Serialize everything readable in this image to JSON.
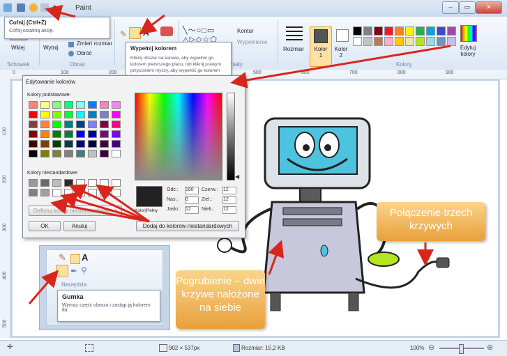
{
  "window": {
    "title": "Paint",
    "min": "‒",
    "max": "▭",
    "close": "✕"
  },
  "undo_tip": {
    "title": "Cofnij (Ctrl+Z)",
    "desc": "Cofnij ostatnią akcję."
  },
  "ribbon": {
    "clipboard": {
      "paste": "Wklej",
      "group": "Schowek"
    },
    "image": {
      "select": "Wytnij",
      "resize": "Zmień rozmiar",
      "rotate": "Obróć",
      "group": "Obraz"
    },
    "shapes": {
      "outline": "Kontur",
      "fill": "Wypełnienie",
      "group": "Kształty"
    },
    "size": "Rozmiar",
    "color1": "Kolor 1",
    "color2": "Kolor 2",
    "edit_colors": "Edytuj kolory",
    "colors_group": "Kolory"
  },
  "fill_tip": {
    "title": "Wypełnij kolorem",
    "desc": "Kliknij obszar na kanwie, aby wypełnić go kolorem pierwszego planu, lub kliknij prawym przyciskiem myszy, aby wypełnić go kolorem tła."
  },
  "ruler": {
    "labels": [
      "0",
      "100",
      "200",
      "300",
      "400",
      "500",
      "600",
      "700",
      "800",
      "900"
    ]
  },
  "vruler": {
    "labels": [
      "100",
      "200",
      "300",
      "400",
      "500"
    ]
  },
  "dialog": {
    "title": "Edytowanie kolorów",
    "basic_label": "Kolory podstawowe:",
    "custom_label": "Kolory niestandardowe:",
    "define_button": "Definiuj kolory niestandardowe >>",
    "ok": "OK",
    "cancel": "Anuluj",
    "add_button": "Dodaj do kolorów niestandardowych",
    "solid_label": "Kolor|Pełny",
    "hue_label": "Odc.:",
    "hue": "160",
    "sat_label": "Nas.:",
    "sat": "0",
    "lum_label": "Jaskr.:",
    "lum": "12",
    "red_label": "Czerw.:",
    "red": "12",
    "green_label": "Ziel.:",
    "green": "12",
    "blue_label": "Nieb.:",
    "blue": "12"
  },
  "tools_inset": {
    "group": "Narzędzia"
  },
  "eraser_tip": {
    "title": "Gumka",
    "desc": "Wymaż część obrazu i zastąp ją kolorem tła."
  },
  "callouts": {
    "curves": "Połączenie trzech krzywych",
    "thick": "Pogrubienie – dwie krzywe nałożone na siebie"
  },
  "status": {
    "dims": "902 × 537px",
    "size": "Rozmiar: 15,2 KB",
    "zoom": "100%"
  },
  "palette_colors": [
    "#000000",
    "#7f7f7f",
    "#880015",
    "#ed1c24",
    "#ff7f27",
    "#fff200",
    "#22b14c",
    "#00a2e8",
    "#3f48cc",
    "#a349a4",
    "#ffffff",
    "#c3c3c3",
    "#b97a57",
    "#ffaec9",
    "#ffc90e",
    "#efe4b0",
    "#b5e61d",
    "#99d9ea",
    "#7092be",
    "#c8bfe7"
  ],
  "basic_colors": [
    "#ff8080",
    "#ffff80",
    "#80ff80",
    "#00ff80",
    "#80ffff",
    "#0080ff",
    "#ff80c0",
    "#ff80ff",
    "#ff0000",
    "#ffff00",
    "#80ff00",
    "#00ff40",
    "#00ffff",
    "#0080c0",
    "#8080c0",
    "#ff00ff",
    "#804040",
    "#ff8040",
    "#00ff00",
    "#008080",
    "#004080",
    "#8080ff",
    "#800040",
    "#ff0080",
    "#800000",
    "#ff8000",
    "#008000",
    "#008040",
    "#0000ff",
    "#0000a0",
    "#800080",
    "#8000ff",
    "#400000",
    "#804000",
    "#004000",
    "#004040",
    "#000080",
    "#000040",
    "#400040",
    "#400080",
    "#000000",
    "#808000",
    "#808040",
    "#808080",
    "#408080",
    "#c0c0c0",
    "#400040",
    "#ffffff"
  ],
  "custom_colors": [
    "#9a9a9a",
    "#6a6a6a",
    "#bcbcbc",
    "#2a2a2a",
    "#ffffff",
    "#ffffff",
    "#ffffff",
    "#ffffff",
    "#808080",
    "#a0a0a0",
    "#ffffff",
    "#ffffff",
    "#ffffff",
    "#ffffff",
    "#ffffff",
    "#ffffff"
  ],
  "accent": {
    "callout": "#f0ad4e",
    "arrow": "#d9261c",
    "monitor": "#4ec3e0"
  }
}
